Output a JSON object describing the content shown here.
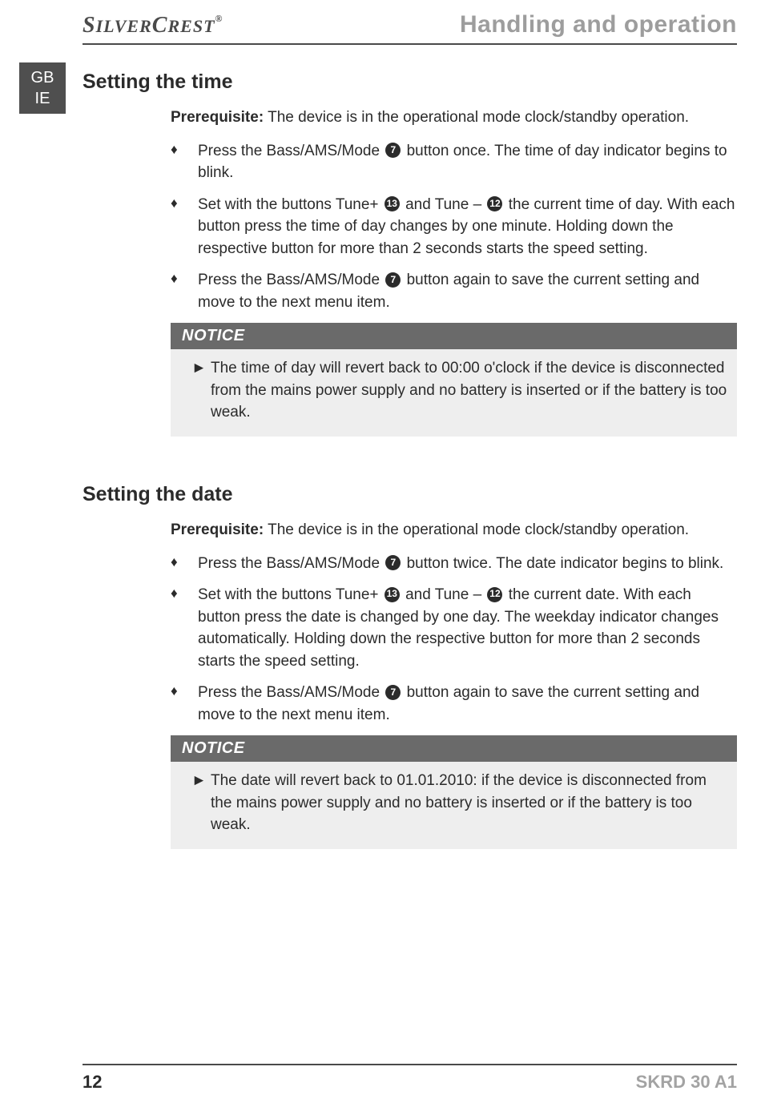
{
  "logo": {
    "part1": "S",
    "part2": "ILVER",
    "part3": "C",
    "part4": "REST",
    "reg": "®"
  },
  "header_title": "Handling and operation",
  "lang_tab": {
    "line1": "GB",
    "line2": "IE"
  },
  "sections": [
    {
      "heading": "Setting the time",
      "prereq_label": "Prerequisite:",
      "prereq_text": " The device is in the operational mode clock/standby operation.",
      "steps": [
        {
          "pre": "Press the Bass/AMS/Mode ",
          "ref1": "7",
          "post1": " button once. The time of day indicator begins to blink."
        },
        {
          "pre": "Set with the buttons Tune+ ",
          "ref1": "13",
          "mid": " and Tune – ",
          "ref2": "12",
          "post1": " the current time of day. With each button press the time of day changes by one minute. Holding down the respective button for more than 2 seconds starts the speed setting."
        },
        {
          "pre": "Press the Bass/AMS/Mode ",
          "ref1": "7",
          "post1": " button again to save the current setting and move to the next menu item."
        }
      ],
      "notice_label": "NOTICE",
      "notice_text": "The time of day will revert back to 00:00 o'clock if the device is disconnected from the mains power supply and no battery is inserted or if the battery is too weak."
    },
    {
      "heading": "Setting the date",
      "prereq_label": "Prerequisite:",
      "prereq_text": " The device is in the operational mode clock/standby operation.",
      "steps": [
        {
          "pre": "Press the Bass/AMS/Mode ",
          "ref1": "7",
          "post1": " button twice. The date indicator begins to blink."
        },
        {
          "pre": "Set with the buttons Tune+ ",
          "ref1": "13",
          "mid": " and Tune – ",
          "ref2": "12",
          "post1": " the current date. With each button press the date is changed by one day. The weekday indicator changes automatically. Holding down the respective button for more than 2 seconds starts the speed setting."
        },
        {
          "pre": "Press the Bass/AMS/Mode ",
          "ref1": "7",
          "post1": " button again to save the current setting and move to the next menu item."
        }
      ],
      "notice_label": "NOTICE",
      "notice_text": "The date will revert back to 01.01.2010: if the device is disconnected from the mains power supply and no battery is inserted or if the battery is too weak."
    }
  ],
  "footer": {
    "page": "12",
    "model": "SKRD 30 A1"
  }
}
